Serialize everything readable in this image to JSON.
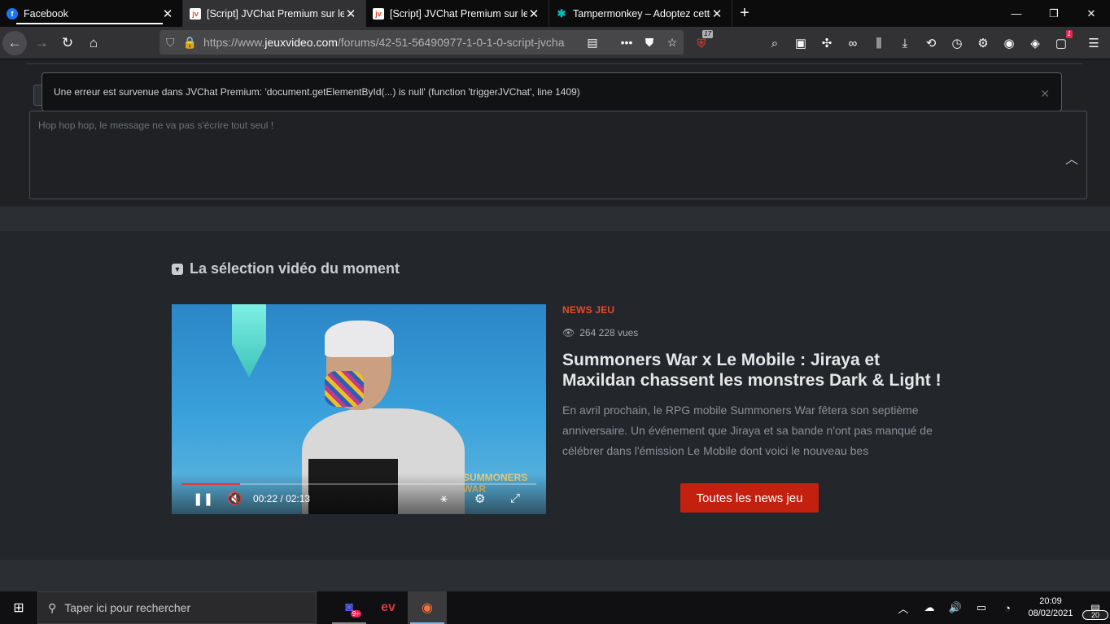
{
  "browser": {
    "tabs": [
      {
        "title": "Facebook",
        "icon": "facebook-icon"
      },
      {
        "title": "[Script] JVChat Premium sur le",
        "icon": "jvc-icon"
      },
      {
        "title": "[Script] JVChat Premium sur le",
        "icon": "jvc-icon"
      },
      {
        "title": "Tampermonkey – Adoptez cette",
        "icon": "tampermonkey-icon"
      }
    ],
    "url": {
      "prefix": "https://www.",
      "domain": "jeuxvideo.com",
      "path": "/forums/42-51-56490977-1-0-1-0-script-jvcha"
    },
    "ublock_badge": "17",
    "ext_badge": "1"
  },
  "page": {
    "error_toast": "Une erreur est survenue dans JVChat Premium: 'document.getElementById(...) is null' (function 'triggerJVChat', line 1409)",
    "message_placeholder": "Hop hop hop, le message ne va pas s'écrire tout seul !",
    "section_title": "La sélection vidéo du moment",
    "video": {
      "current_time": "00:22",
      "separator": "/",
      "duration": "02:13",
      "progress": 0.165,
      "logo_text": "SUMMONERS WAR"
    },
    "article": {
      "tag": "NEWS JEU",
      "views": "264 228 vues",
      "headline": "Summoners War x Le Mobile : Jiraya et Maxildan chassent les monstres Dark & Light !",
      "excerpt": "En avril prochain, le RPG mobile Summoners War fêtera son septième anniversaire. Un événement que Jiraya et sa bande n'ont pas manqué de célébrer dans l'émission Le Mobile dont voici le nouveau bes",
      "cta": "Toutes les news jeu"
    }
  },
  "taskbar": {
    "search_placeholder": "Taper ici pour rechercher",
    "discord_badge": "9+",
    "time": "20:09",
    "date": "08/02/2021",
    "notif_count": "20"
  }
}
